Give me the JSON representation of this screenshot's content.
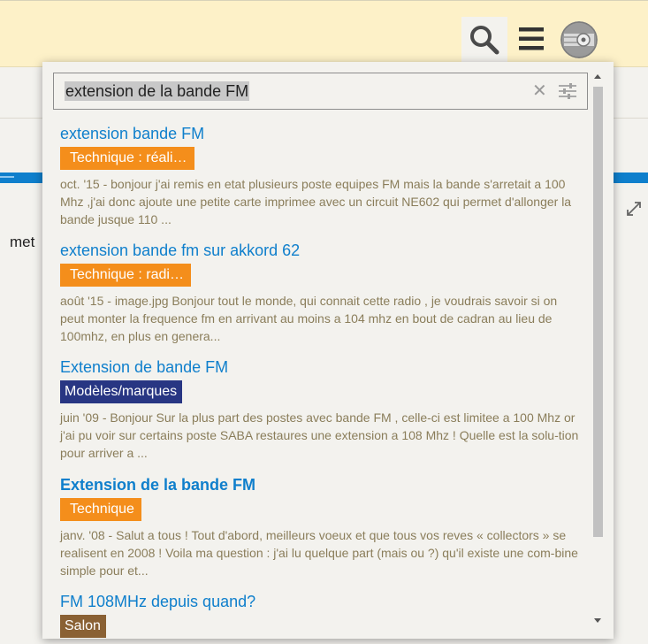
{
  "background": {
    "partial_text": "met"
  },
  "search": {
    "value": "extension de la bande FM"
  },
  "results": [
    {
      "title": "extension bande FM",
      "tag": "Technique : réali…",
      "excerpt": "oct. '15 - bonjour j'ai remis en etat plusieurs poste equipes FM mais la bande s'arretait a 100 Mhz ,j'ai donc ajoute une petite carte imprimee avec un circuit NE602 qui permet d'allonger la bande jusque 110 ..."
    },
    {
      "title": "extension bande fm sur akkord 62",
      "tag": "Technique : radi…",
      "excerpt": "août '15 - image.jpg Bonjour tout le monde, qui connait cette radio , je voudrais savoir si on peut monter la frequence fm en arrivant au moins a 104 mhz en bout de cadran au lieu de 100mhz, en plus en genera..."
    },
    {
      "title": "Extension de bande FM",
      "tag": "Modèles/marques",
      "excerpt": "juin '09 - Bonjour Sur la plus part des postes avec bande FM , celle-ci est limitee a 100 Mhz or j'ai pu voir sur certains poste SABA restaures une extension a 108 Mhz ! Quelle est la solu-tion pour arriver a ..."
    },
    {
      "title": "Extension de la bande FM",
      "tag": "Technique",
      "excerpt": "janv. '08 - Salut a tous ! Tout d'abord, meilleurs voeux et que tous vos reves « collectors » se realisent en 2008 ! Voila ma question : j'ai lu quelque part (mais ou ?) qu'il existe une com-bine simple pour et..."
    },
    {
      "title": "FM 108MHz depuis quand?",
      "tag": "Salon",
      "excerpt": ""
    }
  ],
  "colors": {
    "header_bg": "#fdf1c8",
    "link": "#0f7fcc",
    "tag_orange": "#f48e1b",
    "tag_navy": "#283683",
    "tag_brown": "#8a6134",
    "excerpt": "#8a7d5a"
  },
  "icons": {
    "header_search": "search-icon",
    "header_menu": "hamburger-menu-icon",
    "user": "avatar",
    "clear": "clear-x-icon",
    "filter": "sliders-icon",
    "fullscreen": "expand-icon"
  }
}
